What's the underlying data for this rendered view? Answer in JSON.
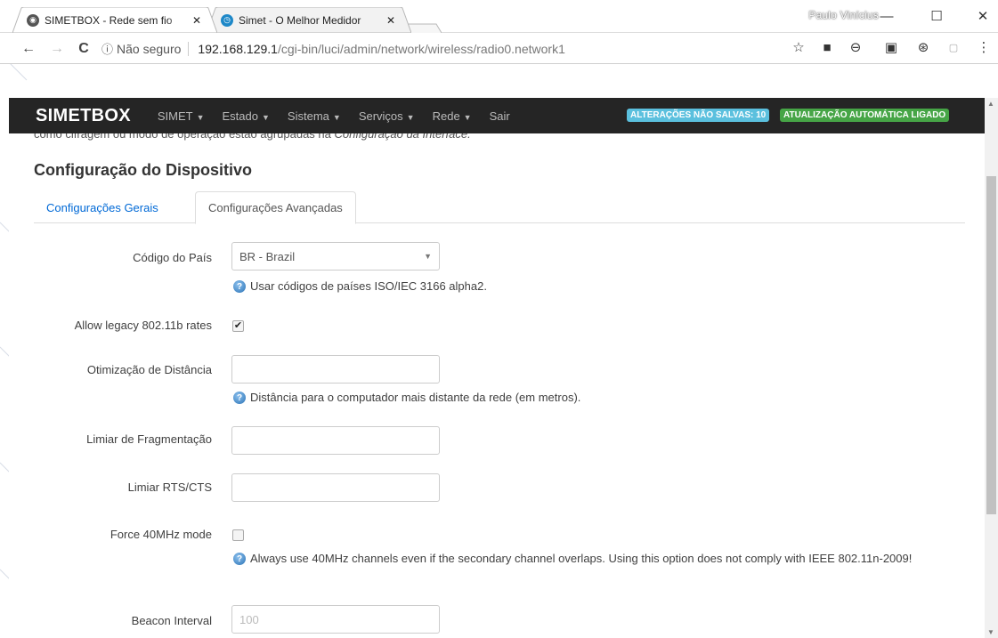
{
  "browser": {
    "tabs": [
      {
        "title": "SIMETBOX - Rede sem fio",
        "active": true
      },
      {
        "title": "Simet - O Melhor Medidor",
        "active": false
      }
    ],
    "user": "Paulo Vinícius",
    "window_buttons": {
      "minimize": "—",
      "maximize": "☐",
      "close": "✕"
    },
    "nav": {
      "back": "←",
      "forward": "→",
      "reload": "C"
    },
    "address": {
      "security_icon": "ⓘ",
      "security_label": "Não seguro",
      "host": "192.168.129.1",
      "path": "/cgi-bin/luci/admin/network/wireless/radio0.network1"
    },
    "extensions": [
      "star-icon",
      "extension-icon",
      "sync-icon",
      "extension-icon",
      "extension-icon",
      "extension-icon",
      "menu-icon"
    ]
  },
  "navbar": {
    "brand": "SIMETBOX",
    "items": [
      "SIMET",
      "Estado",
      "Sistema",
      "Serviços",
      "Rede"
    ],
    "sair": "Sair",
    "badge_unsaved": "ALTERAÇÕES NÃO SALVAS: 10",
    "badge_autorefresh": "ATUALIZAÇÃO AUTOMÁTICA LIGADO"
  },
  "content": {
    "cut_text": "como cifragem ou modo de operação estão agrupadas na ",
    "cut_text_em": "Configuração da Interface.",
    "section_title": "Configuração do Dispositivo",
    "tabs": {
      "general": "Configurações Gerais",
      "advanced": "Configurações Avançadas"
    },
    "fields": {
      "country": {
        "label": "Código do País",
        "value": "BR - Brazil",
        "help": "Usar códigos de países ISO/IEC 3166 alpha2."
      },
      "legacy": {
        "label": "Allow legacy 802.11b rates",
        "checked": true,
        "check_glyph": "✔"
      },
      "distance": {
        "label": "Otimização de Distância",
        "value": "",
        "help": "Distância para o computador mais distante da rede (em metros)."
      },
      "frag": {
        "label": "Limiar de Fragmentação",
        "value": ""
      },
      "rts": {
        "label": "Limiar RTS/CTS",
        "value": ""
      },
      "force40": {
        "label": "Force 40MHz mode",
        "checked": false,
        "help": "Always use 40MHz channels even if the secondary channel overlaps. Using this option does not comply with IEEE 802.11n-2009!"
      },
      "beacon": {
        "label": "Beacon Interval",
        "placeholder": "100"
      }
    },
    "help_glyph": "?"
  }
}
